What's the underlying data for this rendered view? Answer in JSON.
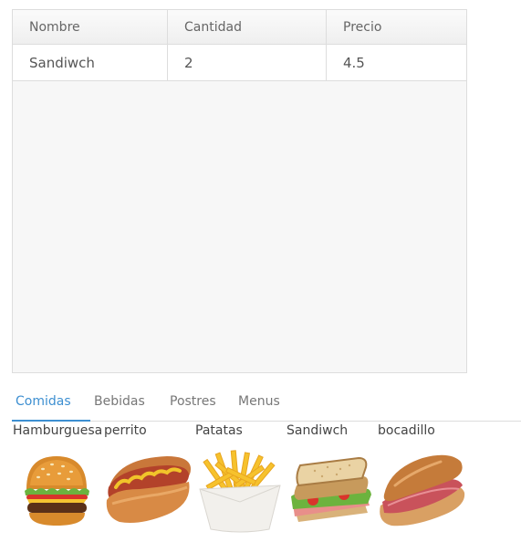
{
  "order_table": {
    "headers": [
      "Nombre",
      "Cantidad",
      "Precio"
    ],
    "rows": [
      {
        "nombre": "Sandiwch",
        "cantidad": "2",
        "precio": "4.5"
      }
    ]
  },
  "tabs": [
    {
      "label": "Comidas",
      "active": true
    },
    {
      "label": "Bebidas",
      "active": false
    },
    {
      "label": "Postres",
      "active": false
    },
    {
      "label": "Menus",
      "active": false
    }
  ],
  "products": [
    {
      "name": "Hamburguesa",
      "icon": "hamburger-image"
    },
    {
      "name": "perrito",
      "icon": "hotdog-image"
    },
    {
      "name": "Patatas",
      "icon": "fries-image"
    },
    {
      "name": "Sandiwch",
      "icon": "sandwich-image"
    },
    {
      "name": "bocadillo",
      "icon": "baguette-sandwich-image"
    }
  ],
  "colors": {
    "accent": "#3d8fd1",
    "border": "#dddddd",
    "table_bg": "#f7f7f7"
  }
}
